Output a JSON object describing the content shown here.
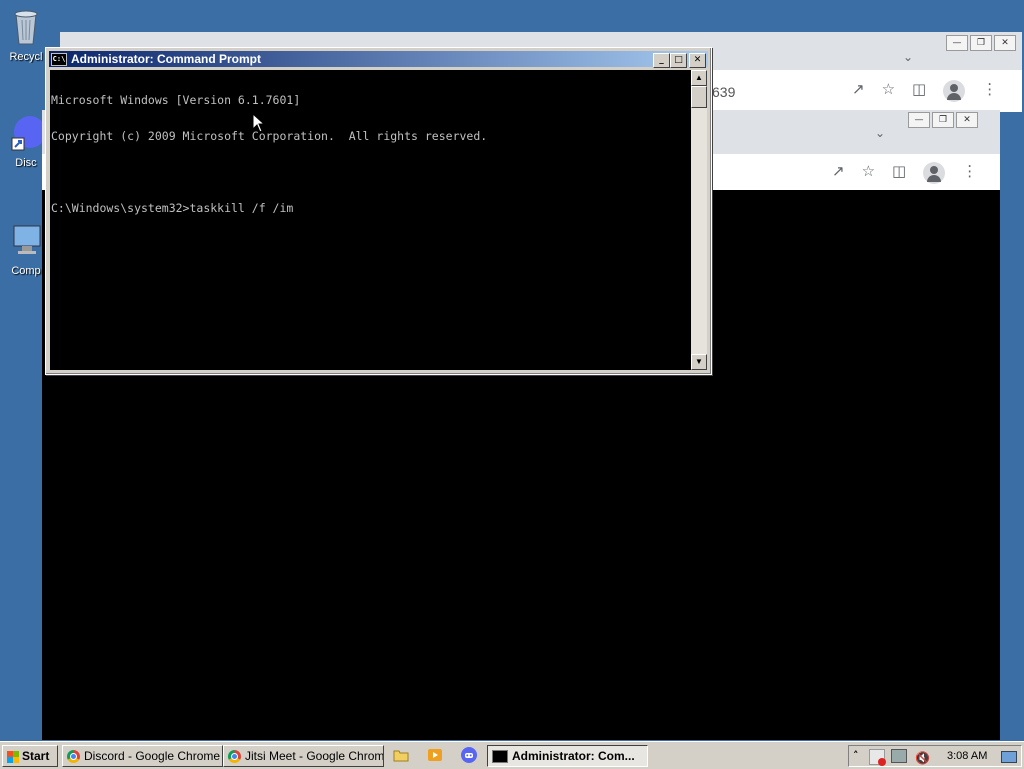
{
  "desktop": {
    "icons": [
      {
        "label": "Recycl",
        "icon": "recycle-bin-icon"
      },
      {
        "label": "Disc",
        "icon": "discord-icon"
      },
      {
        "label": "Comp",
        "icon": "computer-icon"
      }
    ]
  },
  "background_windows": {
    "back_address_fragment": "639"
  },
  "cmd_window": {
    "title": "Administrator: Command Prompt",
    "lines": [
      "Microsoft Windows [Version 6.1.7601]",
      "Copyright (c) 2009 Microsoft Corporation.  All rights reserved.",
      "",
      "C:\\Windows\\system32>taskkill /f /im"
    ]
  },
  "taskbar": {
    "start_label": "Start",
    "buttons": [
      {
        "label": "Discord - Google Chrome",
        "icon": "chrome-icon"
      },
      {
        "label": "Jitsi Meet - Google Chrome",
        "icon": "chrome-icon"
      },
      {
        "label": "Administrator: Com...",
        "icon": "cmd-icon"
      }
    ],
    "quick_launch": [
      "folder-icon",
      "media-player-icon",
      "discord-icon"
    ],
    "clock": "3:08 AM"
  },
  "colors": {
    "desktop": "#3a6ea5",
    "title_gradient_start": "#0a246a",
    "title_gradient_end": "#a6caf0",
    "console_bg": "#000000",
    "console_text": "#c0c0c0"
  }
}
